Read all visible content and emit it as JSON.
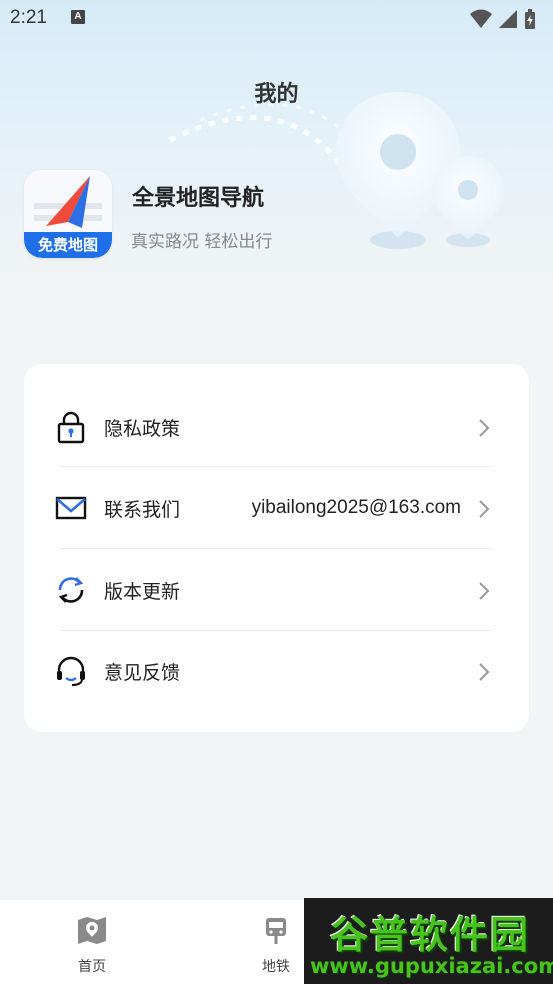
{
  "status_bar": {
    "time": "2:21",
    "indicator": "A",
    "icons": [
      "wifi-icon",
      "cellular-signal-icon",
      "battery-charging-icon"
    ]
  },
  "header": {
    "title": "我的"
  },
  "app_info": {
    "name": "全景地图导航",
    "slogan": "真实路况 轻松出行",
    "icon_badge": "免费地图"
  },
  "menu": {
    "items": [
      {
        "label": "隐私政策",
        "icon": "lock-icon",
        "value": ""
      },
      {
        "label": "联系我们",
        "icon": "mail-icon",
        "value": "yibailong2025@163.com"
      },
      {
        "label": "版本更新",
        "icon": "refresh-icon",
        "value": ""
      },
      {
        "label": "意见反馈",
        "icon": "headset-icon",
        "value": ""
      }
    ]
  },
  "bottom_nav": {
    "items": [
      {
        "label": "首页",
        "icon": "map-icon"
      },
      {
        "label": "地铁",
        "icon": "subway-icon"
      }
    ]
  },
  "watermark": {
    "title": "谷普软件园",
    "url": "www.gupuxiazai.com"
  },
  "colors": {
    "accent_blue": "#1f6fe8",
    "compass_red": "#f04a3b",
    "background": "#f3f4f6",
    "watermark_green": "#48c21d"
  }
}
